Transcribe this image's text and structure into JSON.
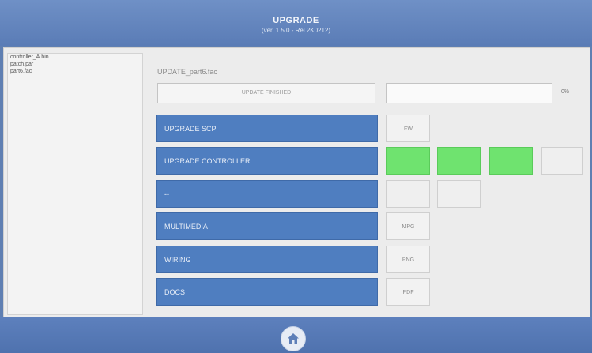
{
  "header": {
    "title": "UPGRADE",
    "version": "(ver. 1.5.0 - Rel.2K0212)"
  },
  "files": [
    {
      "name": "controller_A.bin"
    },
    {
      "name": "patch.par"
    },
    {
      "name": "part6.fac"
    }
  ],
  "update": {
    "file_label": "UPDATE_part6.fac",
    "status": "UPDATE FINISHED",
    "progress_percent": 0,
    "progress_text": "0%"
  },
  "rows": [
    {
      "label": "UPGRADE SCP",
      "chips": [
        "FW"
      ]
    },
    {
      "label": "UPGRADE CONTROLLER",
      "chips": [
        "",
        "",
        "",
        ""
      ]
    },
    {
      "label": "--",
      "chips": [
        "",
        ""
      ]
    },
    {
      "label": "MULTIMEDIA",
      "chips": [
        "MPG"
      ]
    },
    {
      "label": "WIRING",
      "chips": [
        "PNG"
      ]
    },
    {
      "label": "DOCS",
      "chips": [
        "PDF"
      ]
    }
  ],
  "colors": {
    "header_bg": "#6f90c6",
    "row_button": "#4f7ec0",
    "chip_active": "#6fe36f",
    "progress_fill": "#a8c8e0"
  },
  "footer": {
    "home_icon": "home-icon"
  }
}
